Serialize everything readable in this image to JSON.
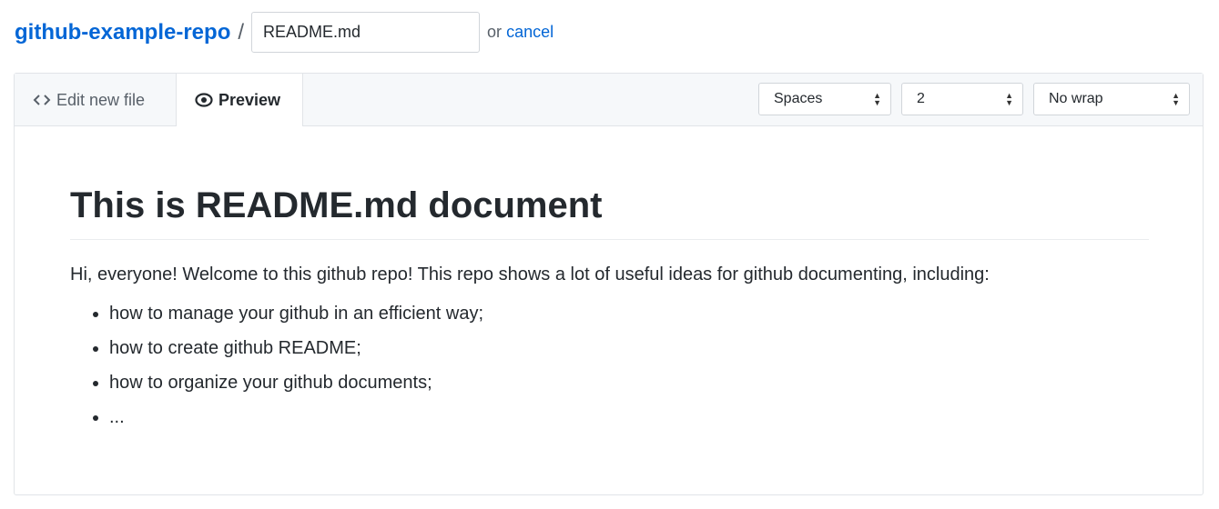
{
  "header": {
    "repo": "github-example-repo",
    "separator": "/",
    "filename": "README.md",
    "or": "or",
    "cancel": "cancel"
  },
  "tabs": [
    {
      "label": "Edit new file",
      "icon": "code-icon"
    },
    {
      "label": "Preview",
      "icon": "eye-icon",
      "active": true
    }
  ],
  "selects": {
    "indent_mode": "Spaces",
    "indent_size": "2",
    "wrap_mode": "No wrap"
  },
  "preview": {
    "heading": "This is README.md document",
    "paragraph": "Hi, everyone! Welcome to this github repo! This repo shows a lot of useful ideas for github documenting, including:",
    "items": [
      "how to manage your github in an efficient way;",
      "how to create github README;",
      "how to organize your github documents;",
      "..."
    ]
  },
  "colors": {
    "link": "#0366d6"
  }
}
